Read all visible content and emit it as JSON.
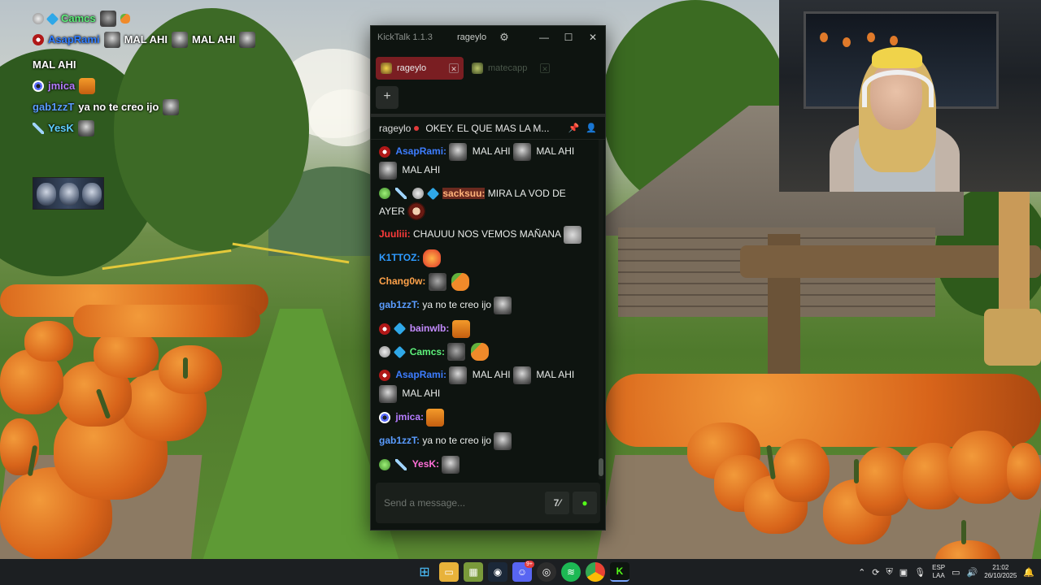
{
  "overlay_chat": [
    {
      "name": "Camcs",
      "color": "#5df07a",
      "badges": [
        "sub",
        "dia"
      ],
      "emotes_after": [
        "mask"
      ],
      "text": ""
    },
    {
      "name": "AsapRami",
      "color": "#2f7cff",
      "badges": [
        "demon"
      ],
      "segments": [
        "MAL AHI",
        "MAL AHI",
        "MAL AHI"
      ]
    },
    {
      "name": "jmica",
      "color": "#b57cff",
      "badges": [
        "eye"
      ],
      "text": ""
    },
    {
      "name": "gab1zzT",
      "color": "#5a9cff",
      "badges": [],
      "text": "ya no te creo ijo"
    },
    {
      "name": "YesK",
      "color": "#5fd0ff",
      "badges": [
        "sword"
      ],
      "text": ""
    }
  ],
  "overlay": {
    "l1_name": "Camcs",
    "l2_name": "AsapRami",
    "l2_text1": "MAL AHI",
    "l2_text2": "MAL AHI",
    "l2_text3": "MAL AHI",
    "l3_name": "jmica",
    "l4_name": "gab1zzT",
    "l4_text": "ya no te creo ijo",
    "l5_name": "YesK"
  },
  "kicktalk": {
    "app_title": "KickTalk 1.1.3",
    "current_user": "rageylo",
    "window_controls": {
      "minimize": "—",
      "maximize": "☐",
      "close": "✕"
    },
    "tabs": [
      {
        "label": "rageylo",
        "active": true
      },
      {
        "label": "matecapp",
        "active": false
      }
    ],
    "add_tab": "+",
    "pinned": {
      "user": "rageylo",
      "message": "OKEY. EL QUE MAS LA M..."
    },
    "input_placeholder": "Send a message...",
    "accent_color": "#53fc18",
    "messages": {
      "m1_name": "AsapRami:",
      "m1_t1": "MAL AHI",
      "m1_t2": "MAL AHI",
      "m1_t3": "MAL AHI",
      "m2_name": "sacksuu:",
      "m2_t": "MIRA LA VOD DE AYER",
      "m3_name": "Juuliii:",
      "m3_t": "CHAUUU NOS VEMOS MAÑANA",
      "m4_name": "K1TTOZ:",
      "m5_name": "Chang0w:",
      "m6_name": "gab1zzT:",
      "m6_t": "ya no te creo ijo",
      "m7_name": "bainwlb:",
      "m8_name": "Camcs:",
      "m9_name": "AsapRami:",
      "m9_t1": "MAL AHI",
      "m9_t2": "MAL AHI",
      "m9_t3": "MAL AHI",
      "m10_name": "jmica:",
      "m11_name": "gab1zzT:",
      "m11_t": "ya no te creo ijo",
      "m12_name": "YesK:"
    }
  },
  "taskbar": {
    "apps": [
      "windows-start",
      "file-explorer",
      "minecraft",
      "steam",
      "discord",
      "obs",
      "spotify",
      "chrome",
      "kicktalk"
    ],
    "discord_badge": "9+",
    "language_top": "ESP",
    "language_bottom": "LAA",
    "time": "21:02",
    "date": "26/10/2025"
  }
}
